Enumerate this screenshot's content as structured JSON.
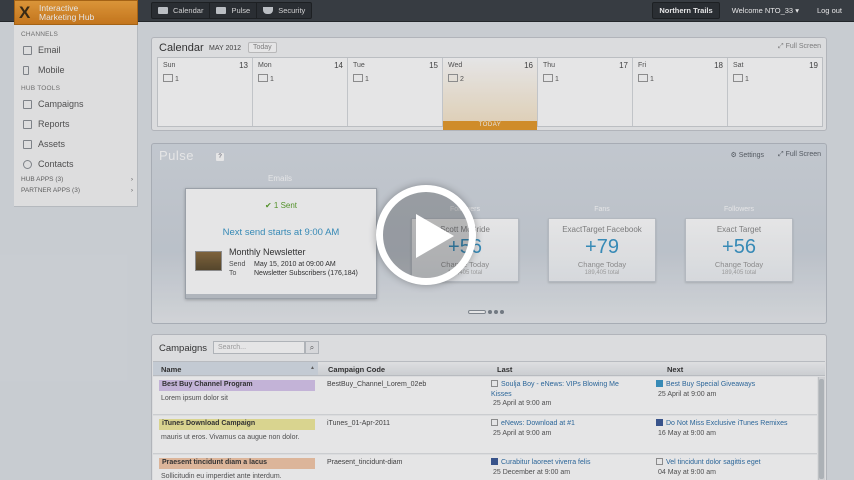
{
  "app": {
    "brand_letter": "X",
    "brand_line1": "Interactive",
    "brand_line2": "Marketing Hub",
    "brand_color": "#e8921f"
  },
  "topnav": {
    "tabs": [
      {
        "label": "Calendar",
        "icon": "calendar-icon"
      },
      {
        "label": "Pulse",
        "icon": "pulse-icon"
      },
      {
        "label": "Security",
        "icon": "shield-icon"
      }
    ],
    "account": "Northern Trails",
    "welcome": "Welcome NTO_33",
    "logout": "Log out"
  },
  "sidebar": {
    "channels_header": "CHANNELS",
    "channels": [
      {
        "label": "Email",
        "icon": "mail-icon"
      },
      {
        "label": "Mobile",
        "icon": "mobile-icon"
      }
    ],
    "hub_tools_header": "HUB TOOLS",
    "tools": [
      {
        "label": "Campaigns",
        "icon": "campaigns-icon"
      },
      {
        "label": "Reports",
        "icon": "reports-icon"
      },
      {
        "label": "Assets",
        "icon": "assets-icon"
      },
      {
        "label": "Contacts",
        "icon": "contacts-icon"
      }
    ],
    "hub_apps": "HUB APPS (3)",
    "partner_apps": "PARTNER APPS (3)"
  },
  "calendar": {
    "title": "Calendar",
    "month": "MAY 2012",
    "today_button": "Today",
    "fullscreen": "Full Screen",
    "days": [
      {
        "name": "Sun",
        "date": "13",
        "count": "1"
      },
      {
        "name": "Mon",
        "date": "14",
        "count": "1"
      },
      {
        "name": "Tue",
        "date": "15",
        "count": "1"
      },
      {
        "name": "Wed",
        "date": "16",
        "count": "2"
      },
      {
        "name": "Thu",
        "date": "17",
        "count": "1"
      },
      {
        "name": "Fri",
        "date": "18",
        "count": "1"
      },
      {
        "name": "Sat",
        "date": "19",
        "count": "1"
      }
    ],
    "today_label": "TODAY"
  },
  "pulse": {
    "title": "Pulse",
    "help": "?",
    "settings": "Settings",
    "fullscreen": "Full Screen",
    "emails_label": "Emails",
    "sent": "1 Sent",
    "next_send": "Next send starts at 9:00 AM",
    "newsletter": "Monthly Newsletter",
    "send_label": "Send",
    "send_value": "May 15, 2010 at 09:00 AM",
    "to_label": "To",
    "to_value": "Newsletter Subscribers (176,184)",
    "metrics": [
      {
        "category": "Followers",
        "name": "Scott McBride",
        "value": "+56",
        "change": "Change Today",
        "total": "189,405 total"
      },
      {
        "category": "Fans",
        "name": "ExactTarget Facebook",
        "value": "+79",
        "change": "Change Today",
        "total": "189,405 total"
      },
      {
        "category": "Followers",
        "name": "Exact Target",
        "value": "+56",
        "change": "Change Today",
        "total": "189,405 total"
      }
    ]
  },
  "campaigns": {
    "title": "Campaigns",
    "search_placeholder": "Search...",
    "columns": [
      "Name",
      "Campaign Code",
      "Last",
      "Next"
    ],
    "rows": [
      {
        "name": "Best Buy Channel Program",
        "color": "#d9c7ee",
        "desc": "Lorem ipsum dolor sit",
        "code": "BestBuy_Channel_Lorem_02eb",
        "last_title": "Soulja Boy - eNews: VIPs Blowing Me Kisses",
        "last_date": "25 April at 9:00 am",
        "next_title": "Best Buy Special Giveaways",
        "next_date": "25 April at 9:00 am"
      },
      {
        "name": "iTunes Download Campaign",
        "color": "#f2ec9c",
        "desc": "mauris ut eros. Vivamus ca augue non dolor.",
        "code": "iTunes_01-Apr-2011",
        "last_title": "eNews: Download at #1",
        "last_date": "25 April at 9:00 am",
        "next_title": "Do Not Miss Exclusive iTunes Remixes",
        "next_date": "16 May at 9:00 am"
      },
      {
        "name": "Praesent tincidunt diam a lacus",
        "color": "#f5c9a9",
        "desc": "Sollicitudin eu imperdiet ante interdum.",
        "code": "Praesent_tincidunt-diam",
        "last_title": "Curabitur laoreet viverra felis",
        "last_date": "25 December at 9:00 am",
        "next_title": "Vel tincidunt dolor sagittis eget",
        "next_date": "04 May at 9:00 am"
      }
    ]
  }
}
